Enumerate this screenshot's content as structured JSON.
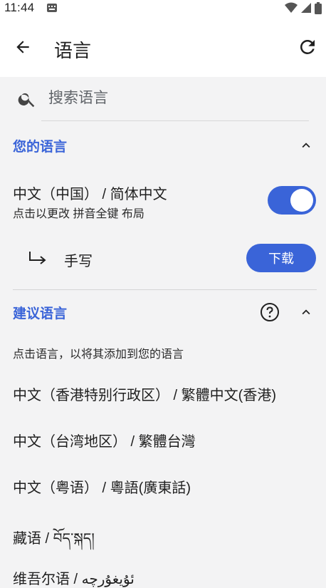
{
  "status_bar": {
    "time": "11:44"
  },
  "app_bar": {
    "title": "语言"
  },
  "search": {
    "placeholder": "搜索语言"
  },
  "your_languages": {
    "title": "您的语言",
    "items": [
      {
        "name": "中文（中国） / 简体中文",
        "subtitle": "点击以更改 拼音全键 布局",
        "enabled": true
      }
    ],
    "handwriting": {
      "label": "手写",
      "action": "下载"
    }
  },
  "suggested_languages": {
    "title": "建议语言",
    "hint": "点击语言，以将其添加到您的语言",
    "items": [
      "中文（香港特别行政区） / 繁體中文(香港)",
      "中文（台湾地区） / 繁體台灣",
      "中文（粤语） / 粵語(廣東話)",
      "藏语 / བོད་སྐད།",
      "维吾尔语 / ئۇيغۇرچە"
    ]
  },
  "colors": {
    "accent": "#3a64d8",
    "background": "#f3f3f4",
    "surface": "#ffffff"
  }
}
